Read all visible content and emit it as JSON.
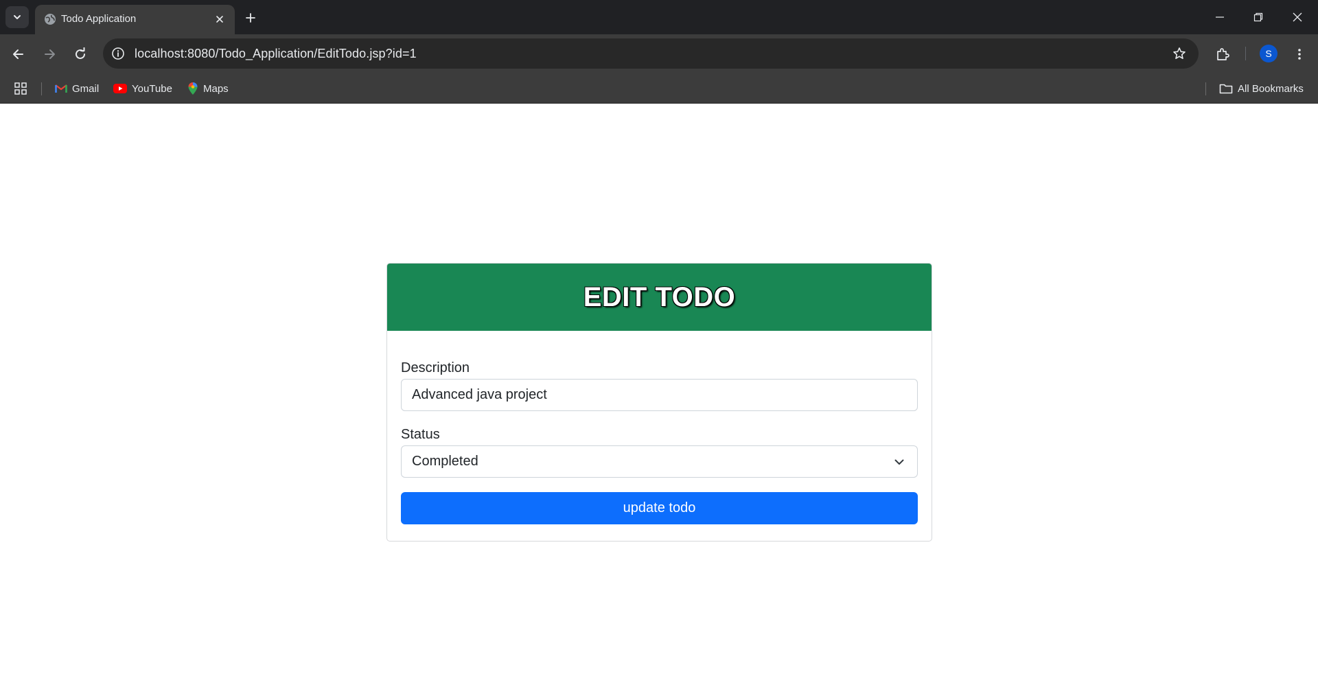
{
  "browser": {
    "tab_title": "Todo Application",
    "url": "localhost:8080/Todo_Application/EditTodo.jsp?id=1",
    "profile_initial": "S",
    "accent_color": "#0b57d0"
  },
  "bookmarks": {
    "items": [
      {
        "label": "Gmail",
        "icon": "gmail-icon"
      },
      {
        "label": "YouTube",
        "icon": "youtube-icon"
      },
      {
        "label": "Maps",
        "icon": "maps-icon"
      }
    ],
    "all_bookmarks_label": "All Bookmarks"
  },
  "form": {
    "header_title": "EDIT TODO",
    "header_color": "#198754",
    "description_label": "Description",
    "description_value": "Advanced java project",
    "status_label": "Status",
    "status_value": "Completed",
    "submit_label": "update todo",
    "submit_color": "#0d6efd"
  }
}
